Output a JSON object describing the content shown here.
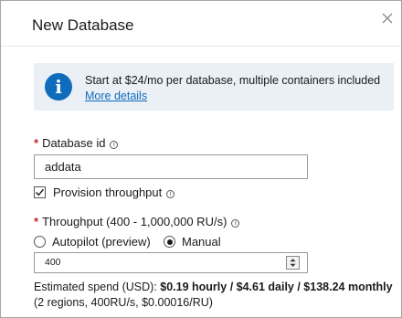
{
  "dialog": {
    "title": "New Database"
  },
  "info": {
    "message": "Start at $24/mo per database, multiple containers included",
    "link": "More details"
  },
  "database_id": {
    "required_mark": "*",
    "label": "Database id",
    "value": "addata"
  },
  "provision": {
    "label": "Provision throughput",
    "checked": true
  },
  "throughput": {
    "required_mark": "*",
    "label": "Throughput (400 - 1,000,000 RU/s)",
    "options": [
      {
        "label": "Autopilot (preview)",
        "selected": false
      },
      {
        "label": "Manual",
        "selected": true
      }
    ],
    "value": "400"
  },
  "estimate": {
    "prefix": "Estimated spend (USD):",
    "amount": "$0.19 hourly / $4.61 daily / $138.24 monthly",
    "details": "(2 regions, 400RU/s, $0.00016/RU)"
  },
  "icons": {
    "close": "close-icon",
    "info": "info-icon",
    "help": "info-circle-icon",
    "check": "checkmark-icon",
    "spinner": "spin-button-icon"
  },
  "colors": {
    "accent": "#0f6cbd",
    "required": "#c4262e",
    "info_background": "#eaf0f6"
  }
}
